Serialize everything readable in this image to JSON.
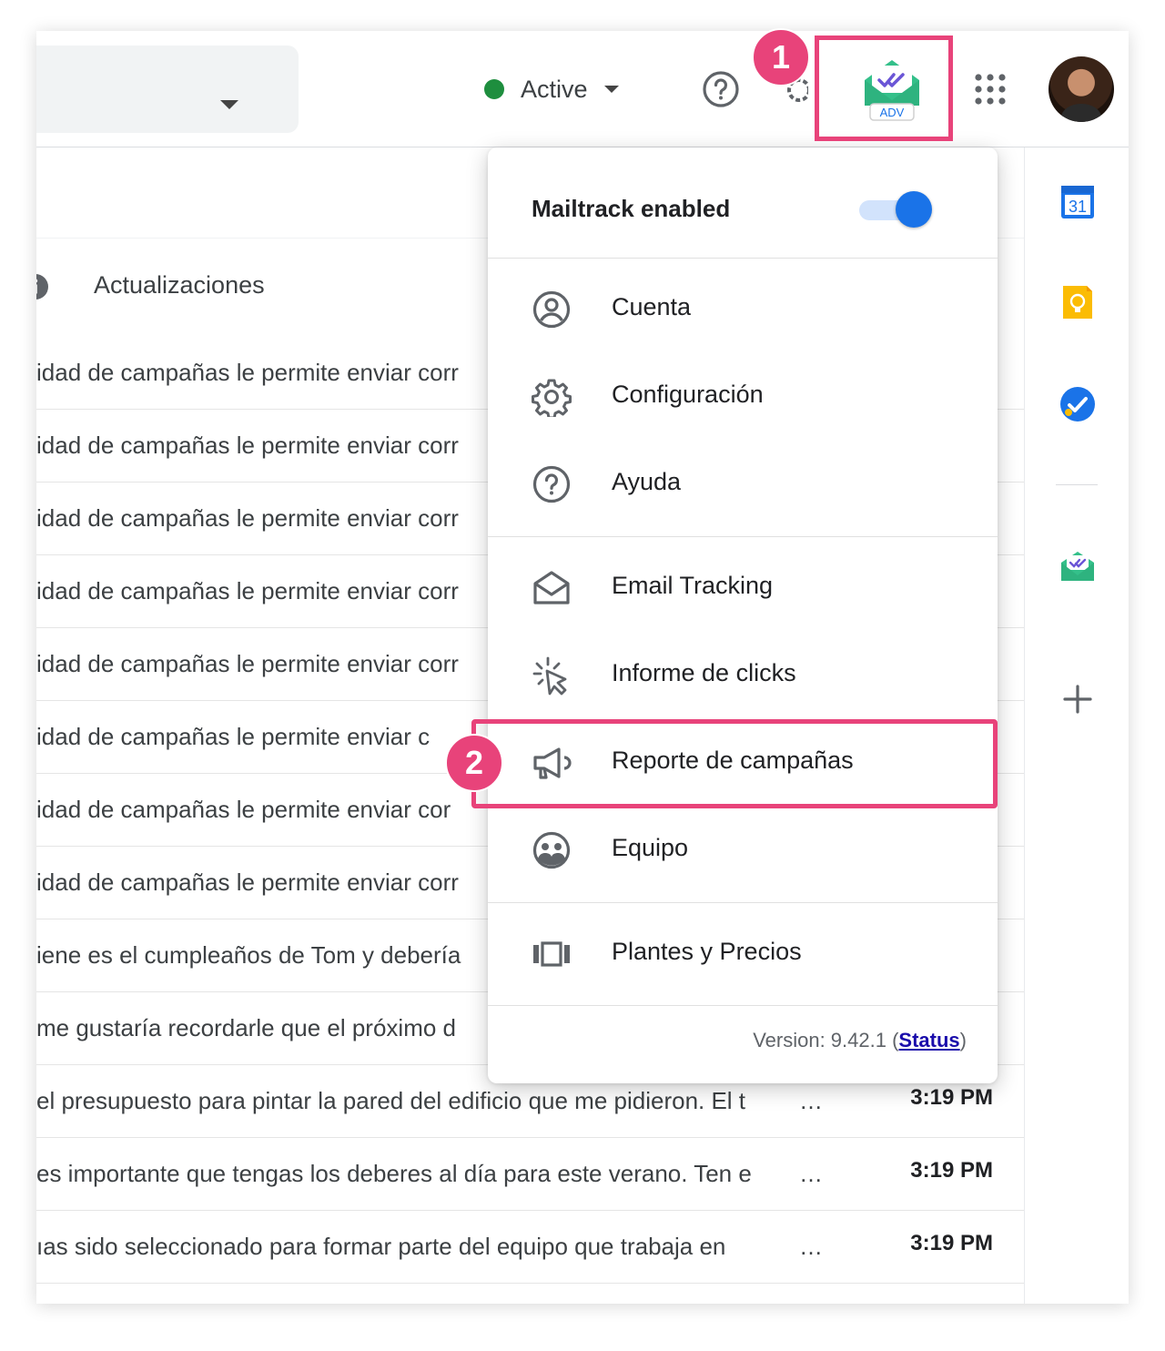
{
  "header": {
    "status_label": "Active",
    "status_color": "#1e8e3e",
    "help_icon": "help-circle-icon",
    "apps_icon": "apps-grid-icon",
    "extension_badge": "ADV",
    "annotation_1": "1"
  },
  "category": {
    "label": "Actualizaciones",
    "icon": "info-icon"
  },
  "emails": [
    {
      "text": "idad de campañas le permite enviar corr",
      "time": ""
    },
    {
      "text": "idad de campañas le permite enviar corr",
      "time": ""
    },
    {
      "text": "idad de campañas le permite enviar corr",
      "time": ""
    },
    {
      "text": "idad de campañas le permite enviar corr",
      "time": ""
    },
    {
      "text": "idad de campañas le permite enviar corr",
      "time": ""
    },
    {
      "text": "idad de campañas le permite enviar c",
      "time": ""
    },
    {
      "text": "idad de campañas le permite enviar cor",
      "time": ""
    },
    {
      "text": "idad de campañas le permite enviar corr",
      "time": ""
    },
    {
      "text": "iene es el cumpleaños de Tom y debería",
      "time": ""
    },
    {
      "text": "me gustaría recordarle que el próximo d",
      "time": ""
    },
    {
      "text": "el presupuesto para pintar la pared del edificio que me pidieron. El t",
      "ellipsis": "…",
      "time": "3:19 PM"
    },
    {
      "text": "es importante que tengas los deberes al día para este verano. Ten e",
      "ellipsis": "…",
      "time": "3:19 PM"
    },
    {
      "text": "ıas sido seleccionado para formar parte del equipo que trabaja en",
      "ellipsis": "…",
      "time": "3:19 PM"
    }
  ],
  "menu": {
    "title": "Mailtrack enabled",
    "toggle_on": true,
    "items": [
      {
        "label": "Cuenta",
        "icon": "account-circle-icon"
      },
      {
        "label": "Configuración",
        "icon": "gear-icon"
      },
      {
        "label": "Ayuda",
        "icon": "help-circle-icon"
      },
      {
        "label": "Email Tracking",
        "icon": "envelope-open-icon"
      },
      {
        "label": "Informe de clicks",
        "icon": "click-cursor-icon"
      },
      {
        "label": "Reporte de campañas",
        "icon": "megaphone-icon"
      },
      {
        "label": "Equipo",
        "icon": "team-icon"
      },
      {
        "label": "Plantes y Precios",
        "icon": "plans-carousel-icon"
      }
    ],
    "version_prefix": "Version: 9.42.1 (",
    "status_link": "Status",
    "version_suffix": ")",
    "annotation_2": "2"
  },
  "side_panel": {
    "calendar_day": "31",
    "icons": [
      "calendar-icon",
      "keep-icon",
      "tasks-icon",
      "mailtrack-icon",
      "add-icon"
    ]
  },
  "colors": {
    "highlight": "#e8437a",
    "accent_blue": "#1a73e8",
    "mailtrack_green": "#34c08a",
    "mailtrack_purple": "#6a55d6"
  }
}
